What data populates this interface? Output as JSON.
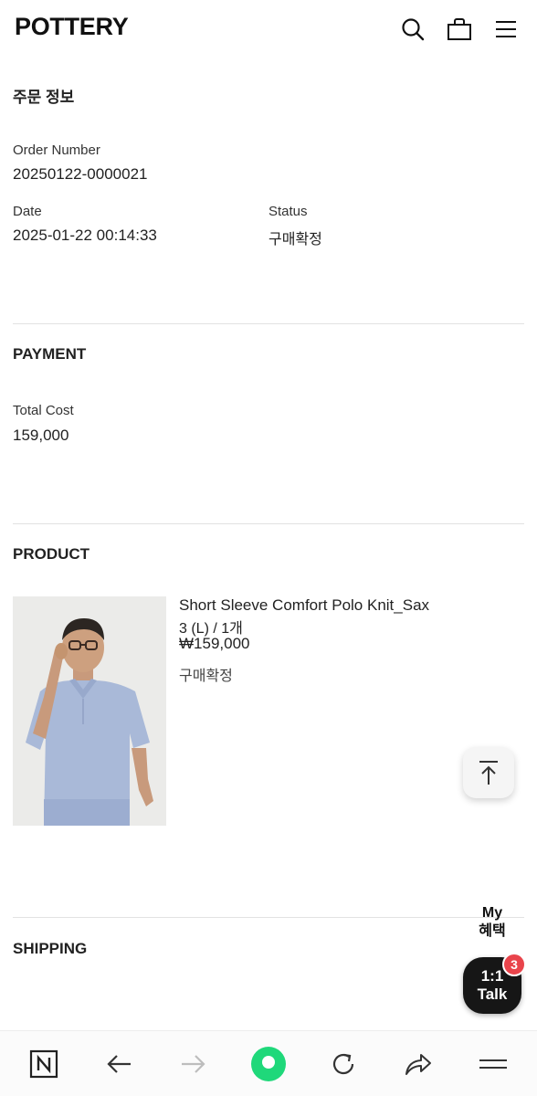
{
  "header": {
    "logo": "POTTERY",
    "icons": [
      "search-icon",
      "shopping-bag-icon",
      "hamburger-menu-icon"
    ]
  },
  "order_info": {
    "title": "주문 정보",
    "order_number_label": "Order Number",
    "order_number": "20250122-0000021",
    "date_label": "Date",
    "date": "2025-01-22 00:14:33",
    "status_label": "Status",
    "status": "구매확정"
  },
  "payment": {
    "title": "PAYMENT",
    "total_cost_label": "Total Cost",
    "total_cost": "159,000"
  },
  "product": {
    "title": "PRODUCT",
    "name": "Short Sleeve Comfort Polo Knit_Sax",
    "option": "3 (L) / 1개",
    "price": "₩159,000",
    "status": "구매확정"
  },
  "shipping": {
    "title": "SHIPPING"
  },
  "floating": {
    "my_line1": "My",
    "my_line2": "혜택",
    "talk_line1": "1:1",
    "talk_line2": "Talk",
    "talk_badge": "3"
  },
  "colors": {
    "accent_green": "#1fd87a",
    "badge_red": "#e9444b",
    "talk_bg": "#161616",
    "product_shirt": "#a9b9d8"
  }
}
